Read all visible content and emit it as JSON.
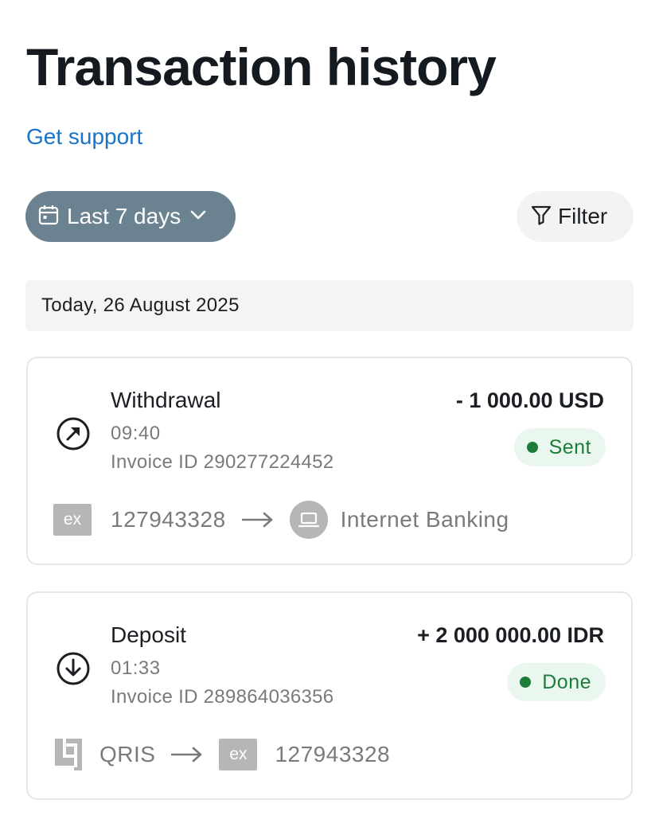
{
  "page": {
    "title": "Transaction history",
    "support_link": "Get support"
  },
  "controls": {
    "period_label": "Last 7 days",
    "filter_label": "Filter"
  },
  "date_group": "Today, 26 August 2025",
  "colors": {
    "accent_link": "#1a73c7",
    "period_button_bg": "#6b8391",
    "status_green": "#1c7d3a",
    "status_bg": "#eaf7ee"
  },
  "transactions": [
    {
      "type": "Withdrawal",
      "direction_icon": "arrow-up-right-circle-icon",
      "time": "09:40",
      "invoice": "Invoice ID 290277224452",
      "amount": "- 1 000.00 USD",
      "status": "Sent",
      "from": {
        "icon": "ex-logo-icon",
        "logo_text": "ex",
        "label": "127943328"
      },
      "to": {
        "icon": "laptop-icon",
        "label": "Internet Banking"
      }
    },
    {
      "type": "Deposit",
      "direction_icon": "arrow-down-circle-icon",
      "time": "01:33",
      "invoice": "Invoice ID 289864036356",
      "amount": "+ 2 000 000.00 IDR",
      "status": "Done",
      "from": {
        "icon": "qris-icon",
        "label": "QRIS"
      },
      "to": {
        "icon": "ex-logo-icon",
        "logo_text": "ex",
        "label": "127943328"
      }
    }
  ]
}
